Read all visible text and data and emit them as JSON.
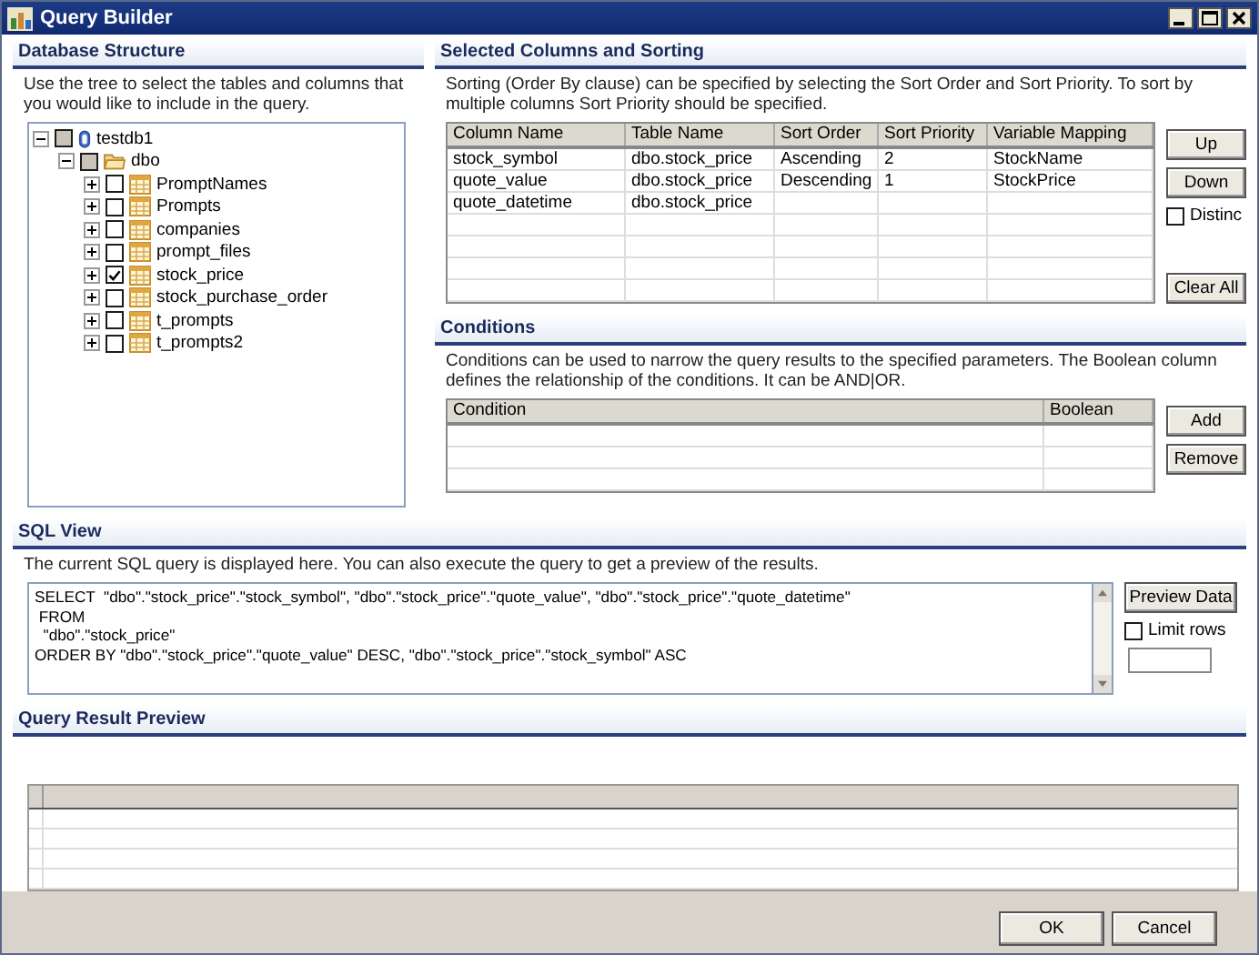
{
  "window": {
    "title": "Query Builder"
  },
  "database_structure": {
    "title": "Database Structure",
    "description": "Use the tree to select the tables and columns that you would like to include in the query.",
    "tree": [
      {
        "label": "testdb1",
        "kind": "database",
        "checked": false,
        "indeterminate": true,
        "expanded": true,
        "children": [
          {
            "label": "dbo",
            "kind": "schema",
            "checked": false,
            "indeterminate": true,
            "expanded": true,
            "children": [
              {
                "label": "PromptNames",
                "kind": "table",
                "checked": false,
                "indeterminate": false,
                "expanded": false
              },
              {
                "label": "Prompts",
                "kind": "table",
                "checked": false,
                "indeterminate": false,
                "expanded": false
              },
              {
                "label": "companies",
                "kind": "table",
                "checked": false,
                "indeterminate": false,
                "expanded": false
              },
              {
                "label": "prompt_files",
                "kind": "table",
                "checked": false,
                "indeterminate": false,
                "expanded": false
              },
              {
                "label": "stock_price",
                "kind": "table",
                "checked": true,
                "indeterminate": false,
                "expanded": false
              },
              {
                "label": "stock_purchase_order",
                "kind": "table",
                "checked": false,
                "indeterminate": false,
                "expanded": false
              },
              {
                "label": "t_prompts",
                "kind": "table",
                "checked": false,
                "indeterminate": false,
                "expanded": false
              },
              {
                "label": "t_prompts2",
                "kind": "table",
                "checked": false,
                "indeterminate": false,
                "expanded": false
              }
            ]
          }
        ]
      }
    ]
  },
  "selected_columns": {
    "title": "Selected Columns and Sorting",
    "description": "Sorting (Order By clause) can be specified by selecting the Sort Order and Sort Priority. To sort by multiple columns Sort Priority should be specified.",
    "columns": [
      "Column Name",
      "Table Name",
      "Sort Order",
      "Sort Priority",
      "Variable Mapping"
    ],
    "rows": [
      [
        "stock_symbol",
        "dbo.stock_price",
        "Ascending",
        "2",
        "StockName"
      ],
      [
        "quote_value",
        "dbo.stock_price",
        "Descending",
        "1",
        "StockPrice"
      ],
      [
        "quote_datetime",
        "dbo.stock_price",
        "",
        "",
        ""
      ]
    ],
    "buttons": [
      "Up",
      "Down"
    ],
    "distinct": {
      "label": "Distinc",
      "checked": false
    },
    "clear_button": "Clear All"
  },
  "conditions": {
    "title": "Conditions",
    "description": "Conditions can be used to narrow the query results to the specified parameters.  The Boolean column defines the relationship of the conditions.  It can be AND|OR.",
    "columns": [
      "Condition",
      "Boolean"
    ],
    "buttons": [
      "Add",
      "Remove"
    ]
  },
  "sql_view": {
    "title": "SQL View",
    "description": "The current SQL query is displayed here.  You can also execute the query to get a preview of the results.",
    "value": "SELECT  \"dbo\".\"stock_price\".\"stock_symbol\", \"dbo\".\"stock_price\".\"quote_value\", \"dbo\".\"stock_price\".\"quote_datetime\"\n FROM\n  \"dbo\".\"stock_price\"\nORDER BY \"dbo\".\"stock_price\".\"quote_value\" DESC, \"dbo\".\"stock_price\".\"stock_symbol\" ASC",
    "preview_button": "Preview Data",
    "limit_rows": {
      "label": "Limit rows",
      "checked": false
    }
  },
  "query_result_preview": {
    "title": "Query Result Preview"
  },
  "buttons": [
    "OK",
    "Cancel"
  ]
}
